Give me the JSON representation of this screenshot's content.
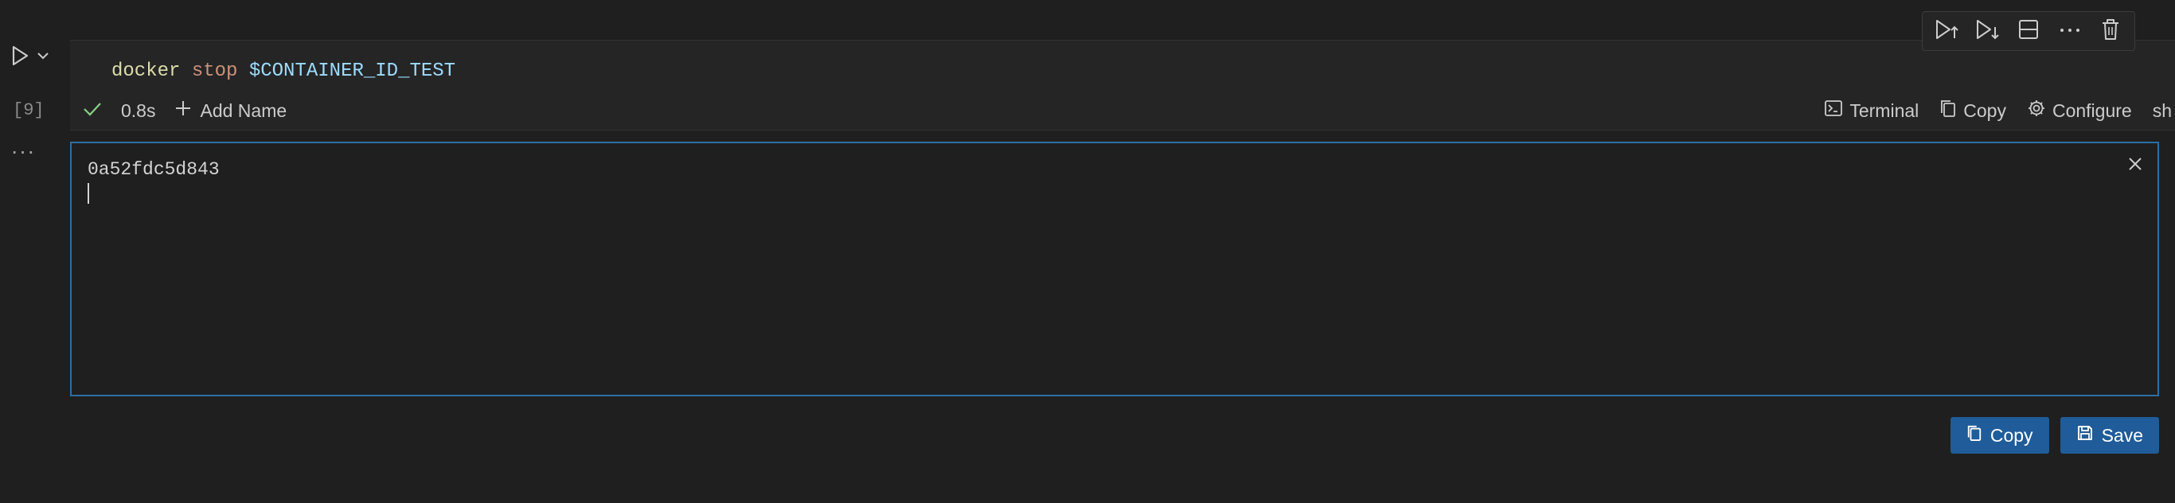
{
  "cell": {
    "code": {
      "command": "docker",
      "subcommand": "stop",
      "variable": "$CONTAINER_ID_TEST"
    },
    "execution_count": "[9]",
    "duration": "0.8s",
    "add_name_label": "Add Name",
    "actions": {
      "terminal_label": "Terminal",
      "copy_label": "Copy",
      "configure_label": "Configure",
      "language_label": "sh"
    }
  },
  "output": {
    "text": "0a52fdc5d843"
  },
  "buttons": {
    "copy_label": "Copy",
    "save_label": "Save"
  },
  "icons": {
    "run": "play-icon",
    "chevron": "chevron-down-icon",
    "gutter_more": "more-icon",
    "toolbar": [
      "run-above-icon",
      "run-below-icon",
      "split-cell-icon",
      "more-icon",
      "trash-icon"
    ],
    "check": "check-icon",
    "add": "plus-icon",
    "terminal": "terminal-icon",
    "copy": "copy-icon",
    "configure": "gear-icon",
    "close": "close-icon",
    "save": "save-icon"
  },
  "colors": {
    "background": "#1f1f1f",
    "cell_background": "#252526",
    "focus_border": "#2d6ea3",
    "button_primary": "#1f5c99",
    "success_check": "#89d185",
    "code_command": "#dcdcaa",
    "code_keyword": "#ce9178",
    "code_variable": "#9cdcfe"
  }
}
